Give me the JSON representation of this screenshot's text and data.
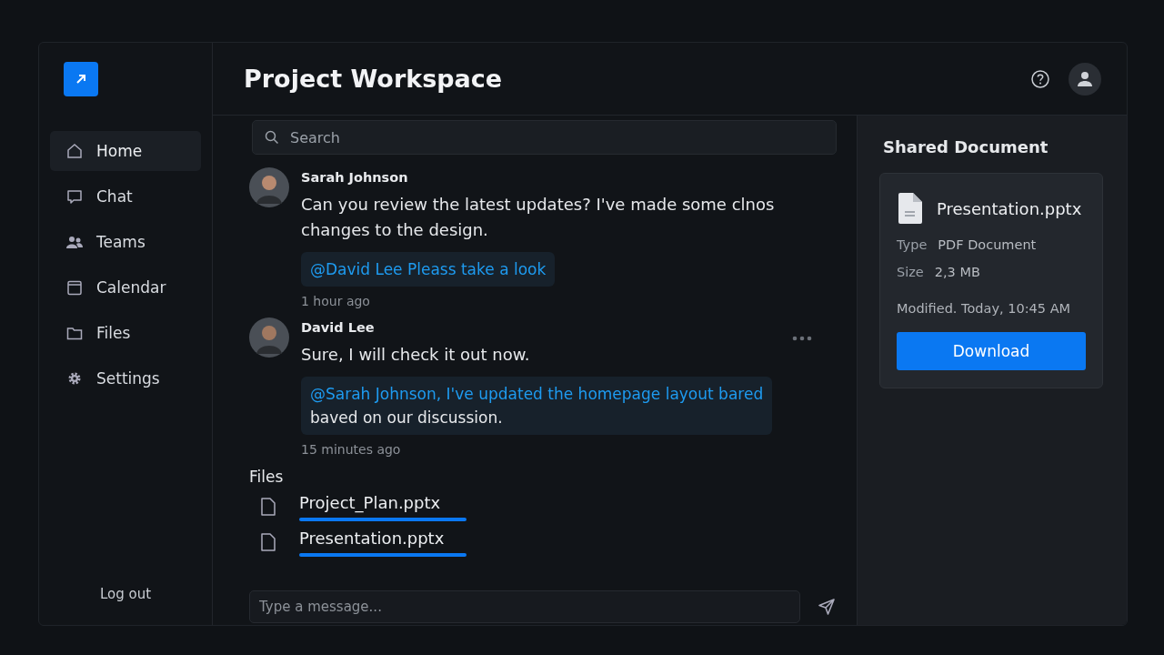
{
  "window": {
    "title": "Project Workspace"
  },
  "sidebar": {
    "items": [
      {
        "label": "Home",
        "kind": "home",
        "selected": true
      },
      {
        "label": "Chat",
        "kind": "chat",
        "selected": false
      },
      {
        "label": "Teams",
        "kind": "people",
        "selected": false
      },
      {
        "label": "Calendar",
        "kind": "calendar",
        "selected": false
      },
      {
        "label": "Files",
        "kind": "folder",
        "selected": false
      },
      {
        "label": "Settings",
        "kind": "gear",
        "selected": false
      }
    ],
    "logout": "Log out"
  },
  "search": {
    "placeholder": "Search"
  },
  "messages": [
    {
      "author": "Sarah Johnson",
      "text": "Can you review the latest updates? I've made some clnos changes to the design.",
      "mention": {
        "highlight": "@David Lee  Pleass take a look"
      },
      "time": "1 hour ago",
      "menu": false
    },
    {
      "author": "David Lee",
      "text": "Sure, I will check it out now.",
      "mention": {
        "highlight": "@Sarah Johnson, I've updated the homepage layout bared",
        "rest": "baved on our discussion."
      },
      "time": "15 minutes ago",
      "menu": true
    }
  ],
  "files": {
    "title": "Files",
    "items": [
      "Project_Plan.pptx",
      "Presentation.pptx"
    ]
  },
  "composer": {
    "placeholder": "Type a message..."
  },
  "shared_document": {
    "title": "Shared Document",
    "name": "Presentation.pptx",
    "details": [
      {
        "label": "Type",
        "value": "PDF Document"
      },
      {
        "label": "Size",
        "value": "2,3 MB"
      }
    ],
    "modified": "Modified. Today, 10:45 AM",
    "button": "Download"
  }
}
